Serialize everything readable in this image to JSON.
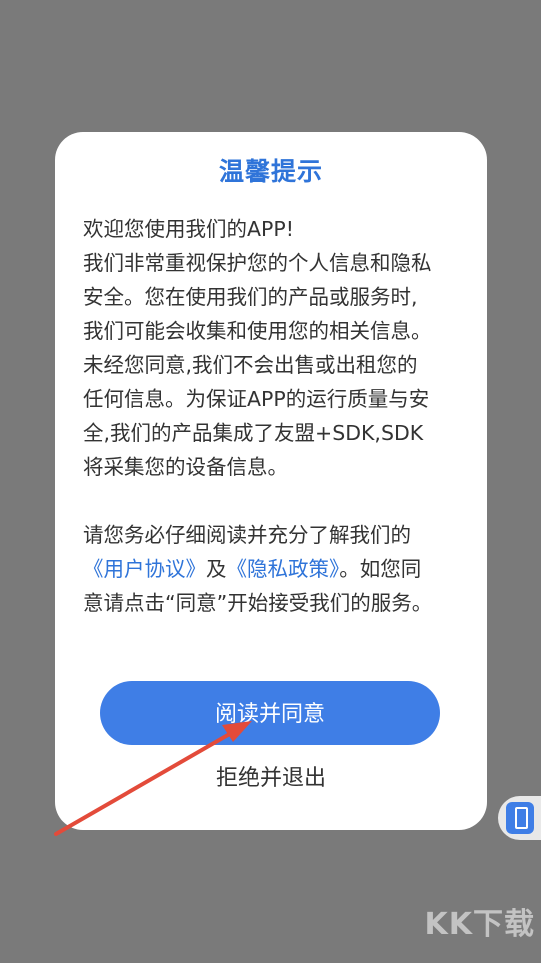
{
  "dialog": {
    "title": "温馨提示",
    "para1_lines": [
      "欢迎您使用我们的APP!",
      "我们非常重视保护您的个人信息和隐私",
      "安全。您在使用我们的产品或服务时,",
      "我们可能会收集和使用您的相关信息。",
      "未经您同意,我们不会出售或出租您的",
      "任何信息。为保证APP的运行质量与安",
      "全,我们的产品集成了友盟+SDK,SDK",
      "将采集您的设备信息。"
    ],
    "para2_line1": "请您务必仔细阅读并充分了解我们的",
    "user_agreement_link": "《用户协议》",
    "and_text": "及",
    "privacy_policy_link": "《隐私政策》",
    "para2_tail": "。如您同",
    "para2_line3": "意请点击“同意”开始接受我们的服务。",
    "agree_button": "阅读并同意",
    "exit_button": "拒绝并退出"
  },
  "watermark": "KK下载",
  "colors": {
    "accent": "#3f7ee6",
    "title": "#2f74d9",
    "overlay": "#7a7a7a",
    "arrow": "#e34b3a"
  }
}
